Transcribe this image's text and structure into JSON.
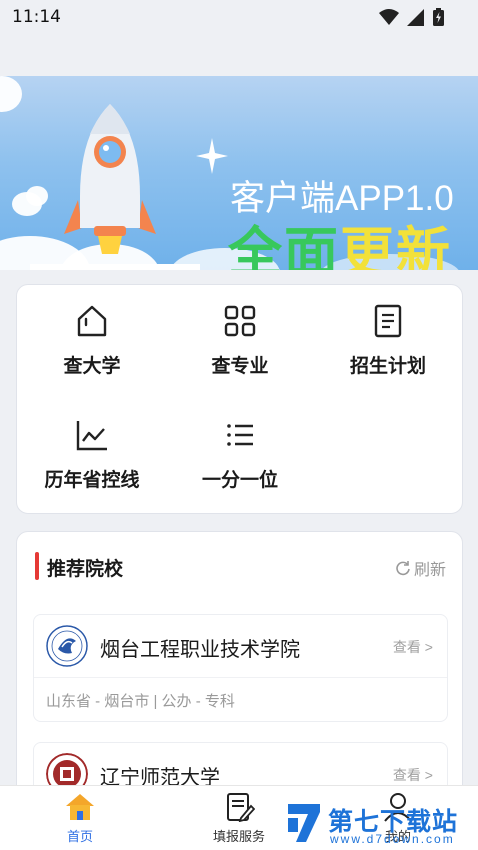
{
  "status_bar": {
    "time": "11:14"
  },
  "banner": {
    "line1": "客户端APP1.0",
    "line2_part_green": "全面",
    "line2_part_yellow": "更新"
  },
  "quick_menu": [
    {
      "label": "查大学",
      "icon": "home-icon"
    },
    {
      "label": "查专业",
      "icon": "grid-icon"
    },
    {
      "label": "招生计划",
      "icon": "document-icon"
    },
    {
      "label": "历年省控线",
      "icon": "line-chart-icon"
    },
    {
      "label": "一分一位",
      "icon": "list-icon"
    }
  ],
  "recommend": {
    "title": "推荐院校",
    "refresh_label": "刷新",
    "schools": [
      {
        "name": "烟台工程职业技术学院",
        "view_label": "查看 >",
        "meta": "山东省 - 烟台市 | 公办 - 专科"
      },
      {
        "name": "辽宁师范大学",
        "view_label": "查看 >",
        "meta": ""
      }
    ]
  },
  "tabbar": {
    "items": [
      {
        "label": "首页",
        "icon": "home-tab-icon",
        "active": true
      },
      {
        "label": "填报服务",
        "icon": "form-edit-icon",
        "active": false
      },
      {
        "label": "我的",
        "icon": "user-icon",
        "active": false
      }
    ]
  },
  "watermark": {
    "title": "第七下载站",
    "url": "www.d7down.com"
  },
  "colors": {
    "accent": "#2f6fe3",
    "red_bar": "#e53935",
    "banner_green": "#38c85c",
    "banner_yellow": "#f2e13a"
  }
}
